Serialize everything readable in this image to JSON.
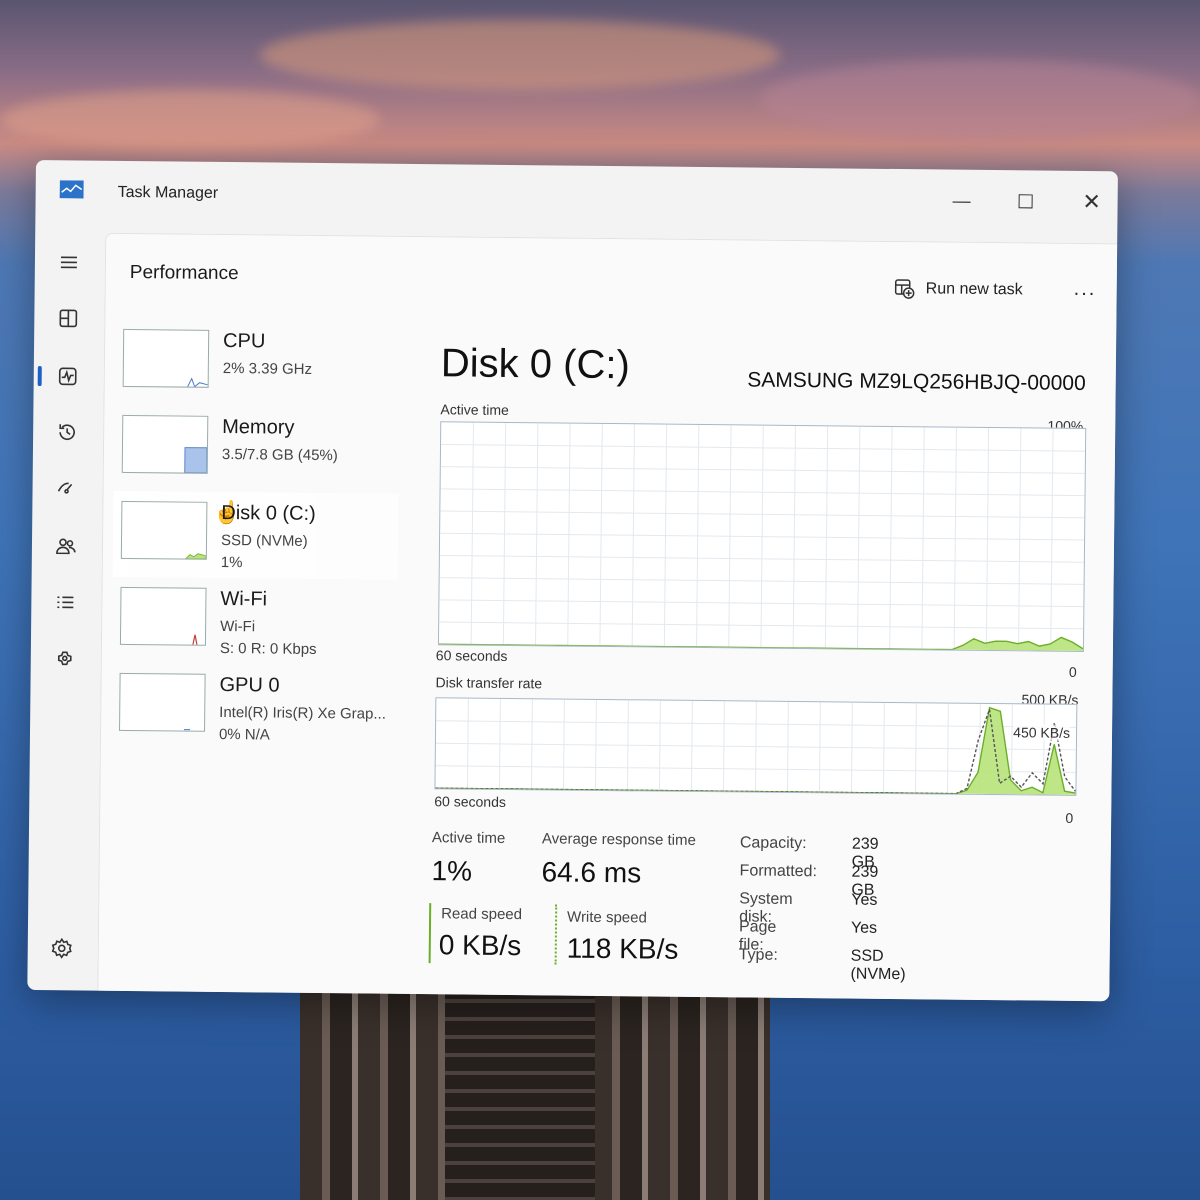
{
  "window": {
    "title": "Task Manager",
    "minimize_icon": "minimize-icon",
    "maximize_icon": "maximize-icon",
    "close_icon": "close-icon"
  },
  "nav": {
    "items": [
      {
        "icon": "hamburger-menu-icon"
      },
      {
        "icon": "processes-icon"
      },
      {
        "icon": "performance-icon",
        "active": true
      },
      {
        "icon": "app-history-icon"
      },
      {
        "icon": "startup-apps-icon"
      },
      {
        "icon": "users-icon"
      },
      {
        "icon": "details-icon"
      },
      {
        "icon": "services-icon"
      }
    ],
    "settings_icon": "settings-gear-icon"
  },
  "header": {
    "title": "Performance",
    "run_task_label": "Run new task",
    "more_label": "..."
  },
  "sidebar": {
    "items": [
      {
        "name": "CPU",
        "line1": "2%  3.39 GHz",
        "line2": ""
      },
      {
        "name": "Memory",
        "line1": "3.5/7.8 GB (45%)",
        "line2": ""
      },
      {
        "name": "Disk 0 (C:)",
        "line1": "SSD (NVMe)",
        "line2": "1%",
        "selected": true
      },
      {
        "name": "Wi-Fi",
        "line1": "Wi-Fi",
        "line2": "S: 0  R: 0 Kbps"
      },
      {
        "name": "GPU 0",
        "line1": "Intel(R) Iris(R) Xe Grap...",
        "line2": "0%  N/A"
      }
    ]
  },
  "detail": {
    "title": "Disk 0 (C:)",
    "model": "SAMSUNG MZ9LQ256HBJQ-00000",
    "active_graph": {
      "label": "Active time",
      "max_label": "100%",
      "time_label": "60 seconds",
      "min_label": "0",
      "activity_percent": [
        0,
        0,
        0,
        0,
        0,
        0,
        0,
        0,
        0,
        0,
        0,
        0,
        0,
        0,
        0,
        0,
        0,
        0,
        0,
        0,
        0,
        0,
        0,
        0,
        0,
        0,
        0,
        0,
        0,
        0,
        0,
        0,
        0,
        0,
        0,
        0,
        0,
        0,
        0,
        0,
        0,
        0,
        0,
        0,
        0,
        0,
        0,
        0,
        2,
        5,
        3,
        4,
        4,
        3,
        4,
        2,
        3,
        6,
        4,
        1
      ]
    },
    "transfer_graph": {
      "label": "Disk transfer rate",
      "max_label": "500 KB/s",
      "mid_label": "450 KB/s",
      "time_label": "60 seconds",
      "min_label": "0",
      "read_kbps": [
        0,
        0,
        0,
        0,
        0,
        0,
        0,
        0,
        0,
        0,
        0,
        0,
        0,
        0,
        0,
        0,
        0,
        0,
        0,
        0,
        0,
        0,
        0,
        0,
        0,
        0,
        0,
        0,
        0,
        0,
        0,
        0,
        0,
        0,
        0,
        0,
        0,
        0,
        0,
        0,
        0,
        0,
        0,
        0,
        0,
        0,
        0,
        0,
        0,
        20,
        120,
        480,
        460,
        80,
        20,
        40,
        10,
        280,
        20,
        10
      ],
      "write_kbps": [
        0,
        0,
        0,
        0,
        0,
        0,
        0,
        0,
        0,
        0,
        0,
        0,
        0,
        0,
        0,
        0,
        0,
        0,
        0,
        0,
        0,
        0,
        0,
        0,
        0,
        0,
        0,
        0,
        0,
        0,
        0,
        0,
        0,
        0,
        0,
        0,
        0,
        0,
        0,
        0,
        0,
        0,
        0,
        0,
        0,
        0,
        0,
        0,
        0,
        30,
        300,
        470,
        60,
        100,
        40,
        120,
        60,
        400,
        100,
        20
      ]
    },
    "stats": {
      "active_time_label": "Active time",
      "active_time_value": "1%",
      "avg_response_label": "Average response time",
      "avg_response_value": "64.6 ms",
      "read_speed_label": "Read speed",
      "read_speed_value": "0 KB/s",
      "write_speed_label": "Write speed",
      "write_speed_value": "118 KB/s"
    },
    "properties": [
      {
        "key": "Capacity:",
        "value": "239 GB"
      },
      {
        "key": "Formatted:",
        "value": "239 GB"
      },
      {
        "key": "System disk:",
        "value": "Yes"
      },
      {
        "key": "Page file:",
        "value": "Yes"
      },
      {
        "key": "Type:",
        "value": "SSD (NVMe)"
      }
    ]
  },
  "colors": {
    "accent": "#1f5fc9",
    "disk_fill": "#b7e37a",
    "disk_line": "#6cae2a",
    "memory_fill": "#a9c3ea",
    "graph_border": "#a7b8c8"
  }
}
